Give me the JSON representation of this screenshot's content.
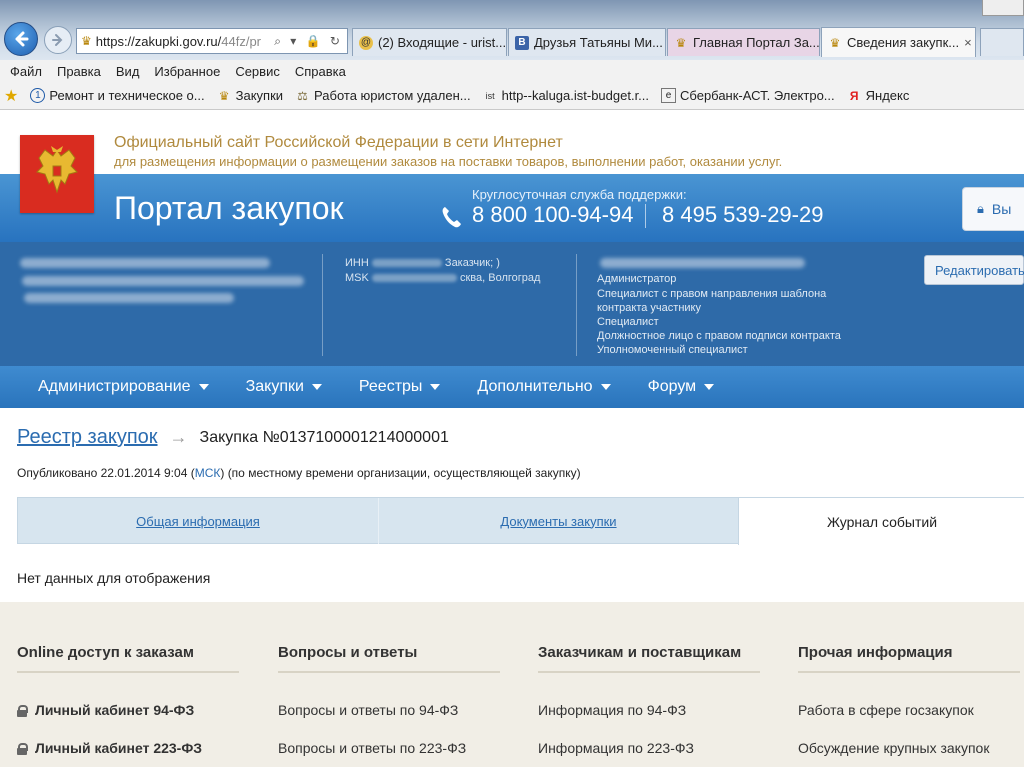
{
  "browser": {
    "url_main": "https://zakupki.gov.ru/",
    "url_tail": "44fz/pr",
    "address_icons": "⌕ ▾ 🔒 ↻",
    "tabs": [
      {
        "label": "(2) Входящие - urist...",
        "icon": "mail-icon"
      },
      {
        "label": "Друзья Татьяны Ми...",
        "icon": "vk-icon"
      },
      {
        "label": "Главная Портал За...",
        "icon": "eagle-icon"
      },
      {
        "label": "Сведения закупк...",
        "icon": "eagle-icon",
        "close": "×"
      }
    ],
    "menu": [
      "Файл",
      "Правка",
      "Вид",
      "Избранное",
      "Сервис",
      "Справка"
    ],
    "favorites": [
      "Ремонт и техническое о...",
      "Закупки",
      "Работа юристом удален...",
      "http--kaluga.ist-budget.r...",
      "Сбербанк-АСТ. Электро...",
      "Яндекс"
    ]
  },
  "site": {
    "title": "Официальный сайт Российской Федерации в сети Интернет",
    "subtitle": "для размещения информации о размещении заказов на поставки товаров, выполнении работ, оказании услуг.",
    "portal_name": "Портал закупок",
    "support_label": "Круглосуточная служба поддержки:",
    "phone1": "8 800 100-94-94",
    "phone2": "8 495 539-29-29",
    "logout_label": "Вы"
  },
  "user": {
    "org_inn": "ИНН",
    "org_role": "Заказчик; )",
    "org_msk": "MSK",
    "org_city": "сква, Волгоград",
    "roles": [
      "Администратор",
      "Специалист с правом направления шаблона",
      "контракта участнику",
      "Специалист",
      "Должностное лицо с правом подписи контракта",
      "Уполномоченный специалист"
    ],
    "edit_label": "Редактировать"
  },
  "nav": [
    {
      "label": "Администрирование"
    },
    {
      "label": "Закупки"
    },
    {
      "label": "Реестры"
    },
    {
      "label": "Дополнительно"
    },
    {
      "label": "Форум"
    }
  ],
  "page": {
    "breadcrumb_link": "Реестр закупок",
    "breadcrumb_arrow": "→",
    "breadcrumb_current": "Закупка №0137100001214000001",
    "published_prefix": "Опубликовано 22.01.2014 9:04 (",
    "published_tz": "МСК",
    "published_suffix": ") (по местному времени организации, осуществляющей закупку)",
    "tabs": [
      "Общая информация",
      "Документы закупки",
      "Журнал событий"
    ],
    "no_data": "Нет данных для отображения"
  },
  "footer": {
    "columns": [
      {
        "heading": "Online доступ к заказам",
        "links": [
          "Личный кабинет 94-ФЗ",
          "Личный кабинет 223-ФЗ"
        ]
      },
      {
        "heading": "Вопросы и ответы",
        "links": [
          "Вопросы и ответы по 94-ФЗ",
          "Вопросы и ответы по 223-ФЗ"
        ]
      },
      {
        "heading": "Заказчикам и поставщикам",
        "links": [
          "Информация по 94-ФЗ",
          "Информация по 223-ФЗ"
        ]
      },
      {
        "heading": "Прочая информация",
        "links": [
          "Работа в сфере госзакупок",
          "Обсуждение крупных закупок"
        ]
      }
    ]
  },
  "colors": {
    "hero_blue": "#2e7bc4",
    "band_blue": "#2e6aa8",
    "link_blue": "#2b6cb0",
    "gold_text": "#b08a3e",
    "emblem_red": "#d92c20",
    "footer_bg": "#f1eee6"
  }
}
